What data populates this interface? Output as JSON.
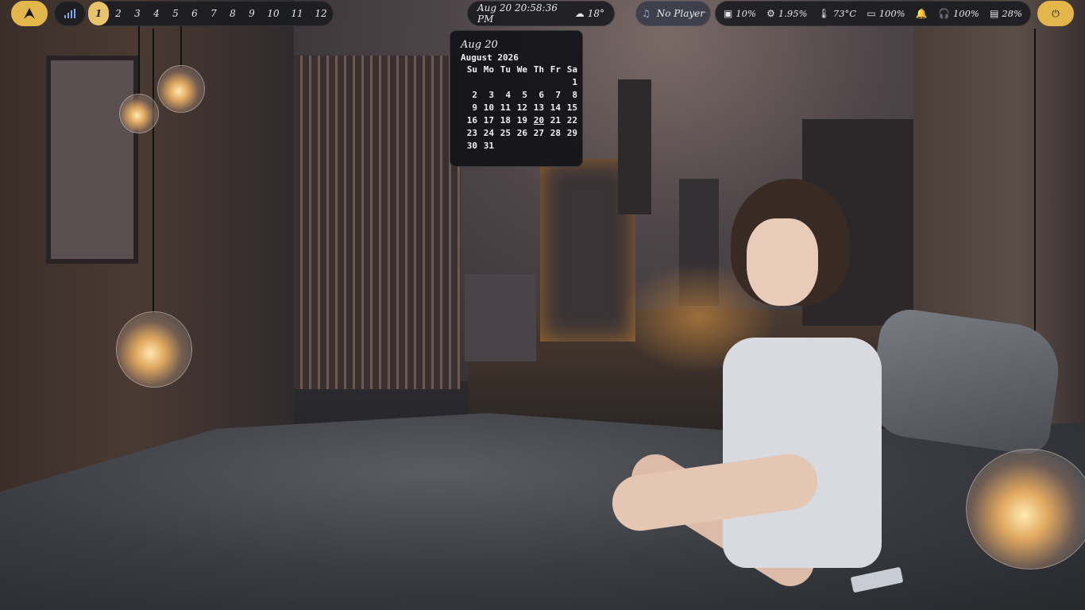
{
  "topbar": {
    "launcher_icon": "arch-logo-icon",
    "network_icon": "signal-bars-icon",
    "workspaces": [
      "1",
      "2",
      "3",
      "4",
      "5",
      "6",
      "7",
      "8",
      "9",
      "10",
      "11",
      "12"
    ],
    "active_workspace": "1",
    "clock": {
      "datetime": "Aug 20 20:58:36 PM",
      "weather_icon": "cloud-icon",
      "temperature": "18°"
    },
    "media": {
      "icon": "music-note-icon",
      "label": "No Player"
    },
    "stats": {
      "cpu": "10%",
      "memory": "1.95%",
      "temperature": "73°C",
      "battery": "100%",
      "volume": "100%",
      "disk": "28%"
    },
    "power_icon": "power-icon",
    "colors": {
      "accent": "#e3b64c",
      "bar_bg": "#1b1c20",
      "media_bg": "#3a3c4a"
    }
  },
  "calendar": {
    "header_date": "Aug 20",
    "month_title": "August 2026",
    "weekdays": [
      "Su",
      "Mo",
      "Tu",
      "We",
      "Th",
      "Fr",
      "Sa"
    ],
    "today": "20",
    "weeks": [
      [
        "",
        "",
        "",
        "",
        "",
        "",
        "1"
      ],
      [
        "2",
        "3",
        "4",
        "5",
        "6",
        "7",
        "8"
      ],
      [
        "9",
        "10",
        "11",
        "12",
        "13",
        "14",
        "15"
      ],
      [
        "16",
        "17",
        "18",
        "19",
        "20",
        "21",
        "22"
      ],
      [
        "23",
        "24",
        "25",
        "26",
        "27",
        "28",
        "29"
      ],
      [
        "30",
        "31",
        "",
        "",
        "",
        "",
        ""
      ]
    ]
  }
}
